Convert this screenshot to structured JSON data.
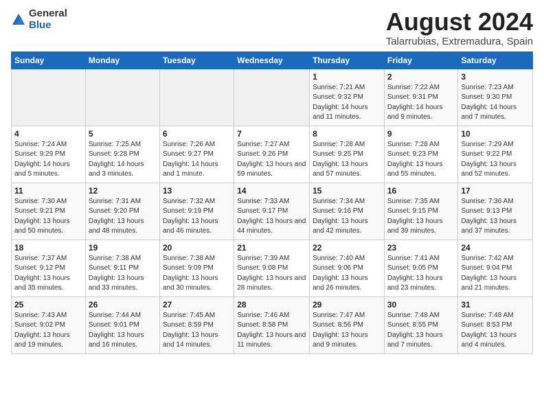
{
  "logo": {
    "general": "General",
    "blue": "Blue"
  },
  "title": "August 2024",
  "location": "Talarrubias, Extremadura, Spain",
  "weekdays": [
    "Sunday",
    "Monday",
    "Tuesday",
    "Wednesday",
    "Thursday",
    "Friday",
    "Saturday"
  ],
  "weeks": [
    [
      {
        "day": "",
        "info": ""
      },
      {
        "day": "",
        "info": ""
      },
      {
        "day": "",
        "info": ""
      },
      {
        "day": "",
        "info": ""
      },
      {
        "day": "1",
        "info": "Sunrise: 7:21 AM\nSunset: 9:32 PM\nDaylight: 14 hours and 11 minutes."
      },
      {
        "day": "2",
        "info": "Sunrise: 7:22 AM\nSunset: 9:31 PM\nDaylight: 14 hours and 9 minutes."
      },
      {
        "day": "3",
        "info": "Sunrise: 7:23 AM\nSunset: 9:30 PM\nDaylight: 14 hours and 7 minutes."
      }
    ],
    [
      {
        "day": "4",
        "info": "Sunrise: 7:24 AM\nSunset: 9:29 PM\nDaylight: 14 hours and 5 minutes."
      },
      {
        "day": "5",
        "info": "Sunrise: 7:25 AM\nSunset: 9:28 PM\nDaylight: 14 hours and 3 minutes."
      },
      {
        "day": "6",
        "info": "Sunrise: 7:26 AM\nSunset: 9:27 PM\nDaylight: 14 hours and 1 minute."
      },
      {
        "day": "7",
        "info": "Sunrise: 7:27 AM\nSunset: 9:26 PM\nDaylight: 13 hours and 59 minutes."
      },
      {
        "day": "8",
        "info": "Sunrise: 7:28 AM\nSunset: 9:25 PM\nDaylight: 13 hours and 57 minutes."
      },
      {
        "day": "9",
        "info": "Sunrise: 7:28 AM\nSunset: 9:23 PM\nDaylight: 13 hours and 55 minutes."
      },
      {
        "day": "10",
        "info": "Sunrise: 7:29 AM\nSunset: 9:22 PM\nDaylight: 13 hours and 52 minutes."
      }
    ],
    [
      {
        "day": "11",
        "info": "Sunrise: 7:30 AM\nSunset: 9:21 PM\nDaylight: 13 hours and 50 minutes."
      },
      {
        "day": "12",
        "info": "Sunrise: 7:31 AM\nSunset: 9:20 PM\nDaylight: 13 hours and 48 minutes."
      },
      {
        "day": "13",
        "info": "Sunrise: 7:32 AM\nSunset: 9:19 PM\nDaylight: 13 hours and 46 minutes."
      },
      {
        "day": "14",
        "info": "Sunrise: 7:33 AM\nSunset: 9:17 PM\nDaylight: 13 hours and 44 minutes."
      },
      {
        "day": "15",
        "info": "Sunrise: 7:34 AM\nSunset: 9:16 PM\nDaylight: 13 hours and 42 minutes."
      },
      {
        "day": "16",
        "info": "Sunrise: 7:35 AM\nSunset: 9:15 PM\nDaylight: 13 hours and 39 minutes."
      },
      {
        "day": "17",
        "info": "Sunrise: 7:36 AM\nSunset: 9:13 PM\nDaylight: 13 hours and 37 minutes."
      }
    ],
    [
      {
        "day": "18",
        "info": "Sunrise: 7:37 AM\nSunset: 9:12 PM\nDaylight: 13 hours and 35 minutes."
      },
      {
        "day": "19",
        "info": "Sunrise: 7:38 AM\nSunset: 9:11 PM\nDaylight: 13 hours and 33 minutes."
      },
      {
        "day": "20",
        "info": "Sunrise: 7:38 AM\nSunset: 9:09 PM\nDaylight: 13 hours and 30 minutes."
      },
      {
        "day": "21",
        "info": "Sunrise: 7:39 AM\nSunset: 9:08 PM\nDaylight: 13 hours and 28 minutes."
      },
      {
        "day": "22",
        "info": "Sunrise: 7:40 AM\nSunset: 9:06 PM\nDaylight: 13 hours and 26 minutes."
      },
      {
        "day": "23",
        "info": "Sunrise: 7:41 AM\nSunset: 9:05 PM\nDaylight: 13 hours and 23 minutes."
      },
      {
        "day": "24",
        "info": "Sunrise: 7:42 AM\nSunset: 9:04 PM\nDaylight: 13 hours and 21 minutes."
      }
    ],
    [
      {
        "day": "25",
        "info": "Sunrise: 7:43 AM\nSunset: 9:02 PM\nDaylight: 13 hours and 19 minutes."
      },
      {
        "day": "26",
        "info": "Sunrise: 7:44 AM\nSunset: 9:01 PM\nDaylight: 13 hours and 16 minutes."
      },
      {
        "day": "27",
        "info": "Sunrise: 7:45 AM\nSunset: 8:59 PM\nDaylight: 13 hours and 14 minutes."
      },
      {
        "day": "28",
        "info": "Sunrise: 7:46 AM\nSunset: 8:58 PM\nDaylight: 13 hours and 11 minutes."
      },
      {
        "day": "29",
        "info": "Sunrise: 7:47 AM\nSunset: 8:56 PM\nDaylight: 13 hours and 9 minutes."
      },
      {
        "day": "30",
        "info": "Sunrise: 7:48 AM\nSunset: 8:55 PM\nDaylight: 13 hours and 7 minutes."
      },
      {
        "day": "31",
        "info": "Sunrise: 7:48 AM\nSunset: 8:53 PM\nDaylight: 13 hours and 4 minutes."
      }
    ]
  ]
}
